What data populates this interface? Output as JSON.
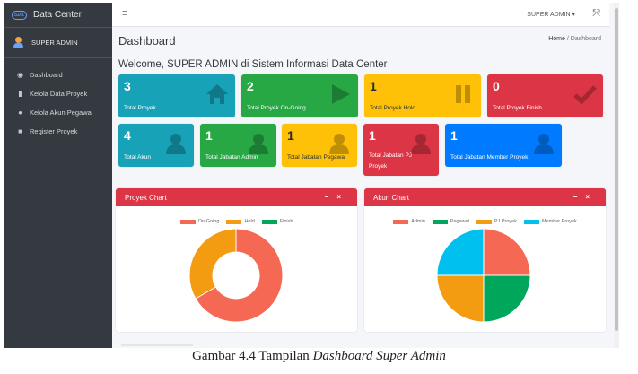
{
  "sidebar": {
    "brand": "Data Center",
    "logo_text": "DATA",
    "user_name": "SUPER ADMIN",
    "items": [
      {
        "icon": "dashboard-icon",
        "label": "Dashboard"
      },
      {
        "icon": "building-icon",
        "label": "Kelola Data Proyek"
      },
      {
        "icon": "users-icon",
        "label": "Kelola Akun Pegawai"
      },
      {
        "icon": "folder-icon",
        "label": "Register Proyek"
      }
    ]
  },
  "topbar": {
    "menu_icon": "hamburger-icon",
    "user_dropdown": "SUPER ADMIN",
    "fullscreen_icon": "fullscreen-icon"
  },
  "page": {
    "title": "Dashboard",
    "breadcrumb_home": "Home",
    "breadcrumb_sep": "/",
    "breadcrumb_current": "Dashboard",
    "welcome": "Welcome, SUPER ADMIN di Sistem Informasi Data Center"
  },
  "stats_row1": [
    {
      "value": "3",
      "label": "Total Proyek",
      "color": "#17a2b8",
      "icon": "home-icon"
    },
    {
      "value": "2",
      "label": "Total Proyek On-Going",
      "color": "#28a745",
      "icon": "play-icon"
    },
    {
      "value": "1",
      "label": "Total Proyek Hold",
      "color": "#ffc107",
      "icon": "pause-icon"
    },
    {
      "value": "0",
      "label": "Total Proyek Finish",
      "color": "#dc3545",
      "icon": "check-icon"
    }
  ],
  "stats_row2": [
    {
      "value": "4",
      "label": "Total Akun",
      "color": "#17a2b8",
      "icon": "user-icon"
    },
    {
      "value": "1",
      "label": "Total Jabatan Admin",
      "color": "#28a745",
      "icon": "user-icon"
    },
    {
      "value": "1",
      "label": "Total Jabatan Pegawai",
      "color": "#ffc107",
      "icon": "user-icon"
    },
    {
      "value": "1",
      "label_line1": "Total Jabatan PJ",
      "label_line2": "Proyek",
      "color": "#dc3545",
      "icon": "user-icon"
    },
    {
      "value": "1",
      "label": "Total Jabatan Member Proyek",
      "color": "#007bff",
      "icon": "user-icon"
    }
  ],
  "proyek_chart": {
    "title": "Proyek Chart",
    "minimize": "−",
    "close": "×"
  },
  "akun_chart": {
    "title": "Akun Chart",
    "minimize": "−",
    "close": "×"
  },
  "chart_data": [
    {
      "type": "pie",
      "style": "doughnut",
      "categories": [
        "On-Going",
        "Hold",
        "Finish"
      ],
      "values": [
        2,
        1,
        0
      ],
      "colors": [
        "#f56954",
        "#f39c12",
        "#00a65a"
      ],
      "legend": "top"
    },
    {
      "type": "pie",
      "categories": [
        "Admin",
        "Pegawai",
        "PJ Proyek",
        "Member Proyek"
      ],
      "values": [
        1,
        1,
        1,
        1
      ],
      "colors": [
        "#f56954",
        "#00a65a",
        "#f39c12",
        "#00c0ef"
      ],
      "legend": "top"
    }
  ],
  "caption": {
    "prefix": "Gambar 4.4 Tampilan",
    "emphasis": "Dashboard Super Admin"
  }
}
